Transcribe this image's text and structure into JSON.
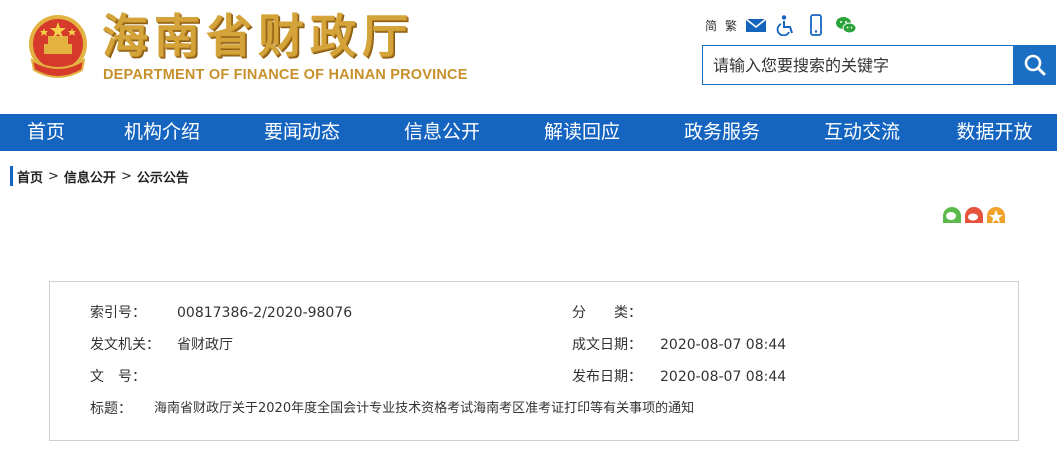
{
  "header": {
    "title_cn": "海南省财政厅",
    "title_en": "DEPARTMENT OF FINANCE OF HAINAN PROVINCE",
    "tools": {
      "simplified": "简",
      "traditional": "繁",
      "icons": [
        "mail-icon",
        "accessibility-icon",
        "mobile-icon",
        "wechat-icon"
      ]
    },
    "search": {
      "placeholder": "请输入您要搜索的关键字"
    },
    "colors": {
      "gold": "#d4a43a",
      "blue": "#1565c0"
    }
  },
  "nav": {
    "items": [
      "首页",
      "机构介绍",
      "要闻动态",
      "信息公开",
      "解读回应",
      "政务服务",
      "互动交流",
      "数据开放"
    ]
  },
  "breadcrumb": {
    "items": [
      "首页",
      "信息公开",
      "公示公告"
    ],
    "separator": ">"
  },
  "share": {
    "icons": [
      "wechat-share-icon",
      "weibo-share-icon",
      "qzone-share-icon"
    ]
  },
  "info": {
    "index_label": "索引号：",
    "index_value": "00817386-2/2020-98076",
    "category_label": "分　　类：",
    "category_value": "",
    "issuer_label": "发文机关：",
    "issuer_value": "省财政厅",
    "created_label": "成文日期：",
    "created_value": "2020-08-07 08:44",
    "docno_label": "文　号：",
    "docno_value": "",
    "published_label": "发布日期：",
    "published_value": "2020-08-07 08:44",
    "title_label": "标题：",
    "title_value": "海南省财政厅关于2020年度全国会计专业技术资格考试海南考区准考证打印等有关事项的通知"
  }
}
